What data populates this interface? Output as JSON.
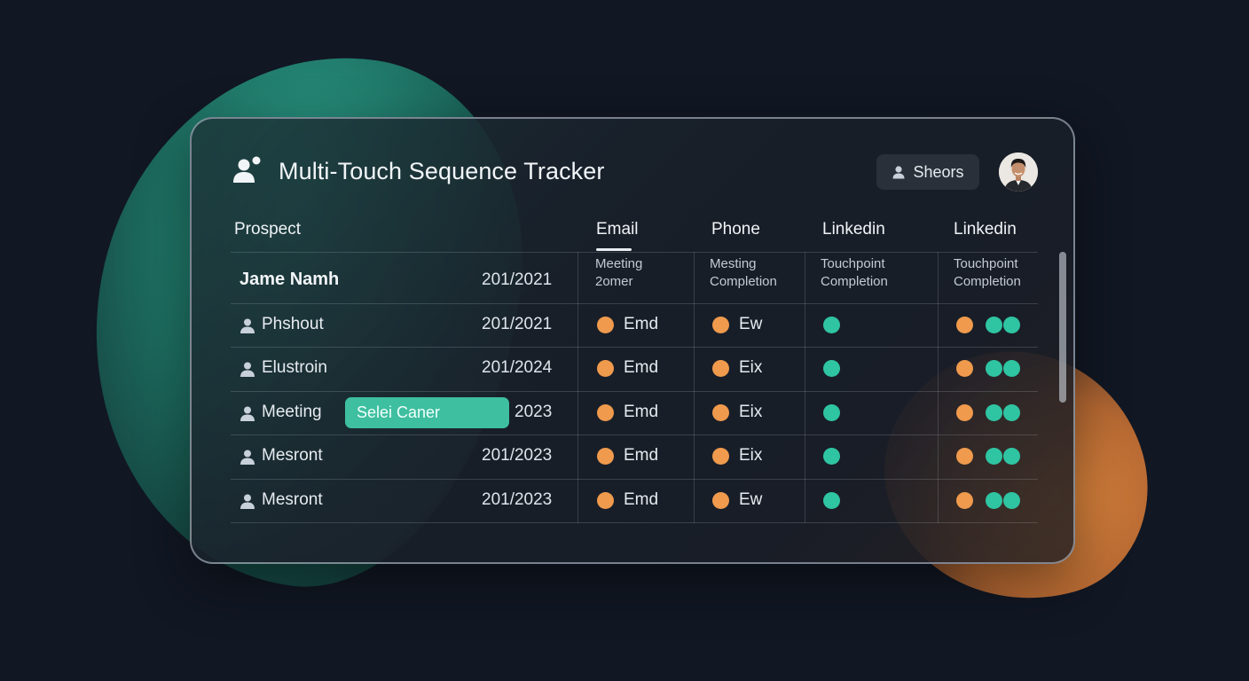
{
  "app": {
    "title": "Multi-Touch Sequence Tracker",
    "user_chip_label": "Sheors"
  },
  "columns": {
    "prospect": "Prospect",
    "email": "Email",
    "phone": "Phone",
    "linkedin_1": "Linkedin",
    "linkedin_2": "Linkedin"
  },
  "subheaders": {
    "email": [
      "Meeting",
      "2omer"
    ],
    "phone": [
      "Mesting",
      "Completion"
    ],
    "linkedin_1": [
      "Touchpoint",
      "Completion"
    ],
    "linkedin_2": [
      "Touchpoint",
      "Completion"
    ]
  },
  "first_row": {
    "name": "Jame Namh",
    "date": "201/2021"
  },
  "rows": [
    {
      "name": "Phshout",
      "date": "201/2021",
      "email": "Emd",
      "phone": "Ew"
    },
    {
      "name": "Elustroin",
      "date": "201/2024",
      "email": "Emd",
      "phone": "Eix"
    },
    {
      "name": "Meeting",
      "date": "2023",
      "email": "Emd",
      "phone": "Eix",
      "tag": "Selei Caner"
    },
    {
      "name": "Mesront",
      "date": "201/2023",
      "email": "Emd",
      "phone": "Eix"
    },
    {
      "name": "Mesront",
      "date": "201/2023",
      "email": "Emd",
      "phone": "Ew"
    }
  ],
  "colors": {
    "background": "#111723",
    "accent_teal": "#2fc4a2",
    "accent_orange": "#ef9a4d",
    "tag_fill": "#3dbfa0"
  },
  "icons": {
    "title": "users-icon",
    "chip": "user-icon",
    "row": "person-icon",
    "status": "status-dot"
  }
}
